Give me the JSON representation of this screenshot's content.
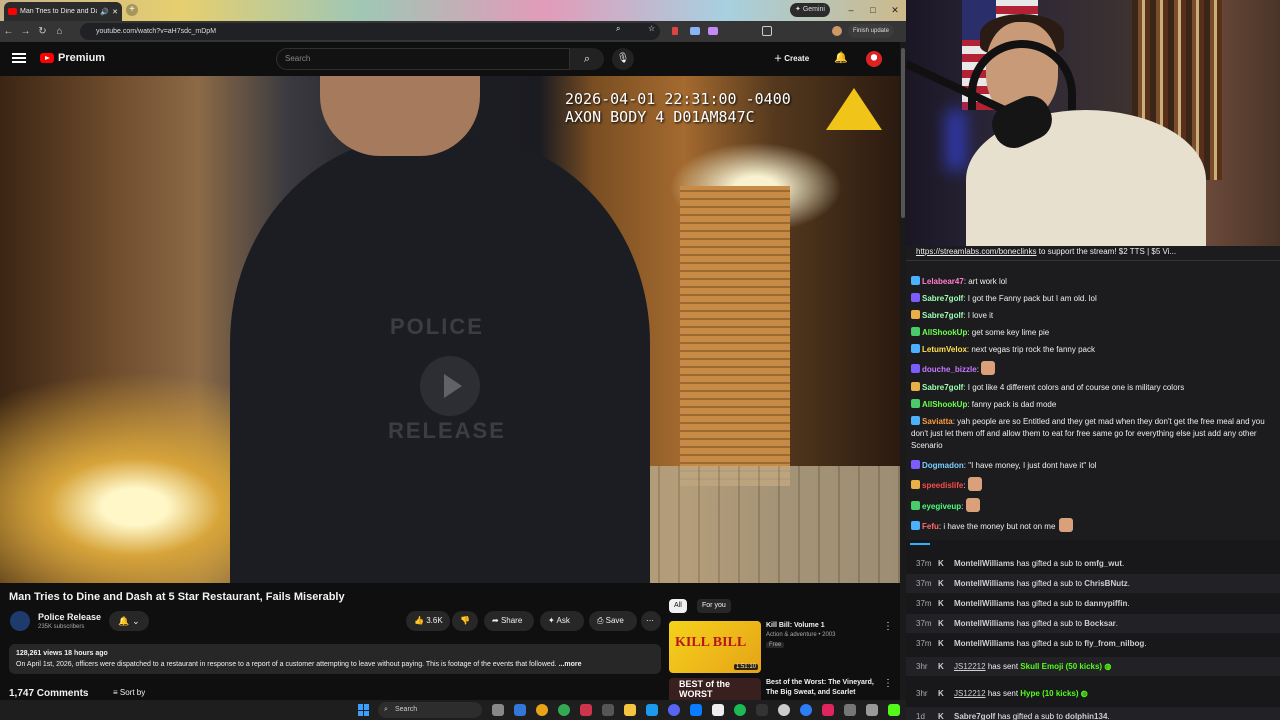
{
  "browser": {
    "tab_title": "Man Tries to Dine and Dash",
    "new_tab": "+",
    "gemini_label": "Gemini",
    "finish_update": "Finish update",
    "url": "youtube.com/watch?v=aH7sdc_mDpM",
    "min": "–",
    "max": "□",
    "close": "✕"
  },
  "youtube": {
    "logo": "Premium",
    "search_placeholder": "Search",
    "create_label": "Create",
    "video": {
      "timestamp_line1": "2026-04-01 22:31:00 -0400",
      "timestamp_line2": "AXON BODY 4 D01AM847C",
      "watermark_top": "POLICE",
      "watermark_bottom": "RELEASE",
      "title": "Man Tries to Dine and Dash at 5 Star Restaurant, Fails Miserably",
      "channel": "Police Release",
      "subscribers": "235K subscribers",
      "likes": "3.6K",
      "share": "Share",
      "ask": "Ask",
      "save": "Save",
      "views_age": "128,261 views  18 hours ago",
      "description": "On April 1st, 2026, officers were dispatched to a restaurant in response to a report of a customer attempting to leave without paying. This is footage of the events that followed.",
      "more": "...more",
      "comments": "1,747 Comments",
      "sort_by": "Sort by"
    },
    "chips": [
      "All",
      "For you"
    ],
    "recommendations": [
      {
        "title": "Kill Bill: Volume 1",
        "meta": "Action & adventure • 2003",
        "badge": "Free",
        "duration": "1:51:10",
        "thumb_text": "KILL BILL"
      },
      {
        "title": "Best of the Worst: The Vineyard, The Big Sweat, and Scarlet",
        "meta": "",
        "badge": "",
        "duration": "",
        "thumb_text": "BEST of the WORST"
      }
    ]
  },
  "chat": {
    "link_url": "https://streamlabs.com/boneclinks",
    "link_rest": " to support the stream! $2 TTS | $5 Vi...",
    "messages": [
      {
        "user": "Lelabear47",
        "color": "#ff7fc8",
        "text": "art work lol"
      },
      {
        "user": "Sabre7golf",
        "color": "#9bffb0",
        "text": "I got the Fanny pack but I am old. lol"
      },
      {
        "user": "Sabre7golf",
        "color": "#9bffb0",
        "text": "I love it"
      },
      {
        "user": "AllShookUp",
        "color": "#6bff4a",
        "text": "get some key lime pie"
      },
      {
        "user": "LetumVelox",
        "color": "#ffe04a",
        "text": "next vegas trip rock the fanny pack"
      },
      {
        "user": "douche_bizzle",
        "color": "#c778ff",
        "text": ""
      },
      {
        "user": "Sabre7golf",
        "color": "#9bffb0",
        "text": "I got like 4 different colors and of course one is military colors"
      },
      {
        "user": "AllShookUp",
        "color": "#6bff4a",
        "text": "fanny pack is dad mode"
      },
      {
        "user": "Saviatta",
        "color": "#ff9a3c",
        "text": "yah people are so Entitled and they get mad when they don't get the free meal and you don't just let them off and allow them to eat for free same go for everything else just add any other Scenario"
      },
      {
        "user": "Dogmadon",
        "color": "#7ad0ff",
        "text": "\"I have money, I just dont have it\" lol"
      },
      {
        "user": "speedislife",
        "color": "#ff4a4a",
        "text": ""
      },
      {
        "user": "eyegiveup",
        "color": "#4aff7a",
        "text": ""
      },
      {
        "user": "Fefu",
        "color": "#ff6b6b",
        "text": "i have the money but not on me"
      }
    ]
  },
  "events": [
    {
      "time": "37m",
      "name": "MontellWilliams",
      "action": " has gifted a sub to ",
      "target": "omfg_wut",
      "end": "."
    },
    {
      "time": "37m",
      "name": "MontellWilliams",
      "action": " has gifted a sub to ",
      "target": "ChrisBNutz",
      "end": "."
    },
    {
      "time": "37m",
      "name": "MontellWilliams",
      "action": " has gifted a sub to ",
      "target": "dannypiffin",
      "end": "."
    },
    {
      "time": "37m",
      "name": "MontellWilliams",
      "action": " has gifted a sub to ",
      "target": "Bocksar",
      "end": "."
    },
    {
      "time": "37m",
      "name": "MontellWilliams",
      "action": " has gifted a sub to ",
      "target": "fly_from_nilbog",
      "end": "."
    },
    {
      "time": "3hr",
      "name": "JS12212",
      "action": " has sent ",
      "target": "Skull Emoji (50 kicks)",
      "end": ""
    },
    {
      "time": "3hr",
      "name": "JS12212",
      "action": " has sent ",
      "target": "Hype (10 kicks)",
      "end": ""
    },
    {
      "time": "1d",
      "name": "Sabre7golf",
      "action": " has gifted a sub to ",
      "target": "dolphin134",
      "end": "."
    }
  ],
  "taskbar": {
    "search": "Search"
  },
  "colors": {
    "yt_red": "#ff0000",
    "kick_green": "#53fc18",
    "axon_yellow": "#f0c419"
  }
}
